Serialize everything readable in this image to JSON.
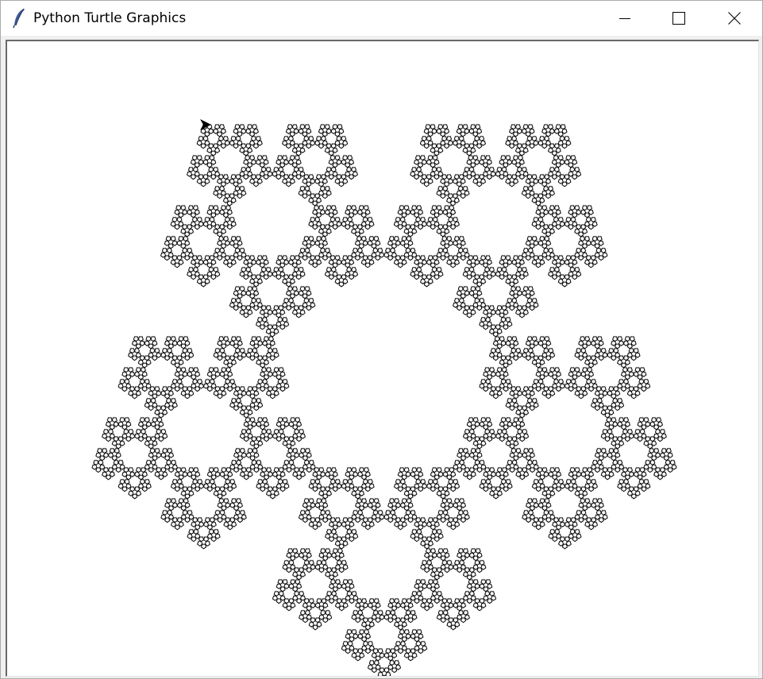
{
  "window": {
    "title": "Python Turtle Graphics",
    "app_icon": "feather-icon",
    "controls": {
      "minimize_icon": "minimize-icon",
      "maximize_icon": "maximize-icon",
      "close_icon": "close-icon"
    }
  },
  "canvas": {
    "background": "#ffffff",
    "pen_color": "#000000",
    "figure": "pentaflake",
    "recursion_depth": 5,
    "turtle_icon": "turtle-arrow-icon"
  }
}
